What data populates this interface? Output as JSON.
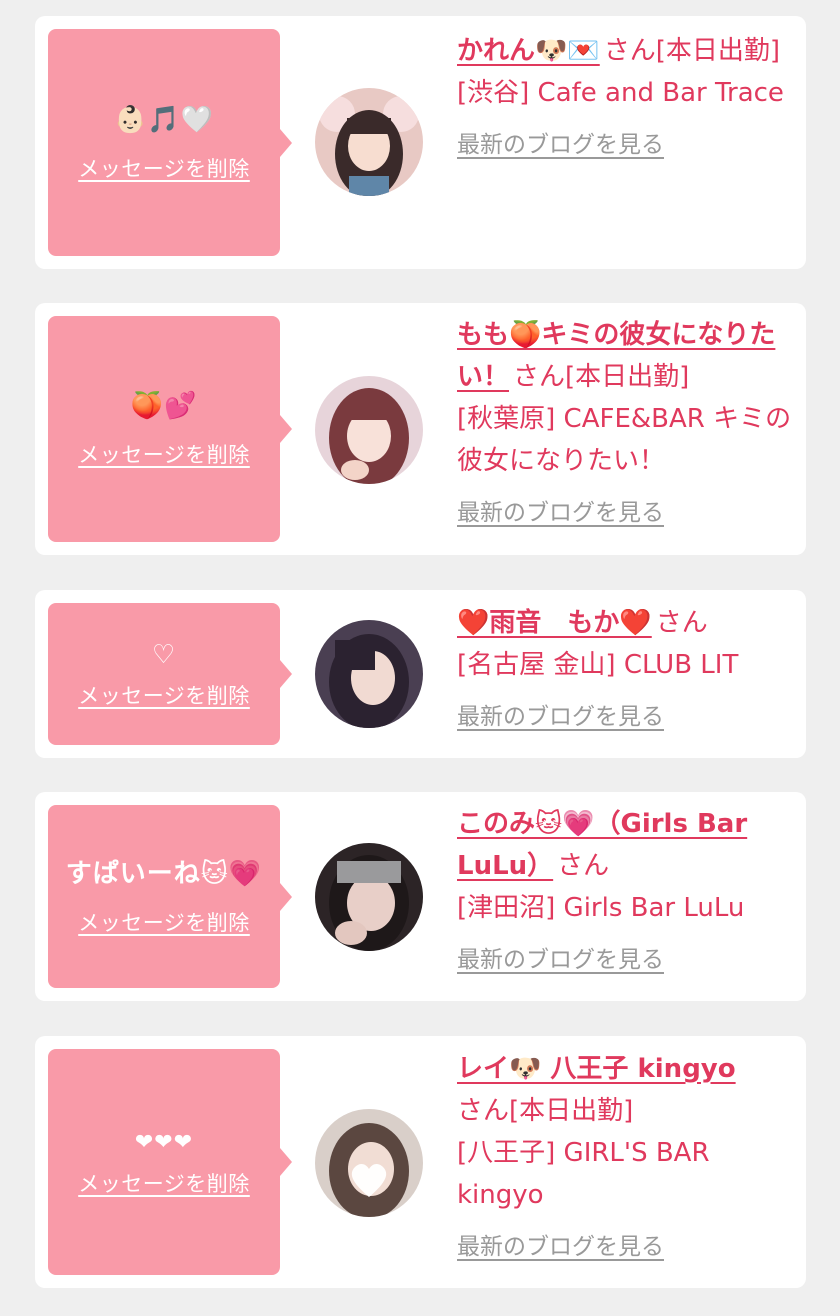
{
  "delete_label": "メッセージを削除",
  "blog_label": "最新のブログを見る",
  "cards": [
    {
      "message": "👶🏻🎵🤍",
      "name": "かれん🐶💌",
      "suffix": "さん[本日出勤]",
      "location": "[渋谷] Cafe and Bar Trace"
    },
    {
      "message": "🍑💕",
      "name": "もも🍑キミの彼女になりたい！",
      "suffix": "さん[本日出勤]",
      "location": "[秋葉原] CAFE&BAR キミの彼女になりたい！"
    },
    {
      "message": "♡",
      "name": "❤️雨音　もか❤️",
      "suffix": "さん",
      "location": "[名古屋 金山] CLUB LIT"
    },
    {
      "message": "すぱいーね🐱💗",
      "name": "このみ🐱💗（Girls Bar LuLu）",
      "suffix": "さん",
      "location": "[津田沼] Girls Bar LuLu"
    },
    {
      "message": "❤❤❤",
      "name": "レイ🐶 八王子 kingyo",
      "suffix": "さん[本日出勤]",
      "location": "[八王子] GIRL'S BAR kingyo"
    }
  ],
  "colors": {
    "background": "#efefef",
    "card": "#ffffff",
    "bubble": "#f99aa8",
    "accent": "#e0395d",
    "muted": "#999999"
  }
}
